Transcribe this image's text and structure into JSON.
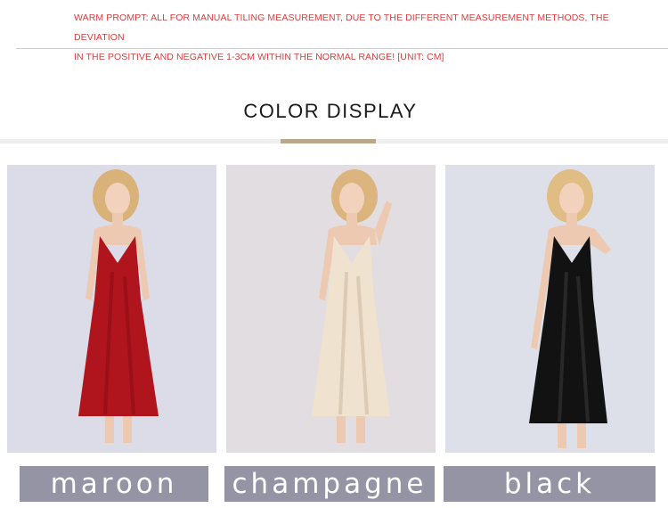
{
  "prompt": {
    "line1": "WARM PROMPT: ALL FOR MANUAL TILING MEASUREMENT, DUE TO THE DIFFERENT MEASUREMENT METHODS, THE DEVIATION",
    "line2": "IN THE POSITIVE AND NEGATIVE 1-3CM WITHIN THE NORMAL RANGE! [UNIT: CM]"
  },
  "section": {
    "title": "COLOR DISPLAY",
    "accent_color": "#b9a98a"
  },
  "colors": [
    {
      "label": "maroon",
      "swatch": "#b0141c",
      "background": "#dcdce8"
    },
    {
      "label": "champagne",
      "swatch": "#efe2cf",
      "background": "#e2dde0"
    },
    {
      "label": "black",
      "swatch": "#121212",
      "background": "#dde0e8"
    }
  ],
  "label_bar_color": "#9594a5"
}
